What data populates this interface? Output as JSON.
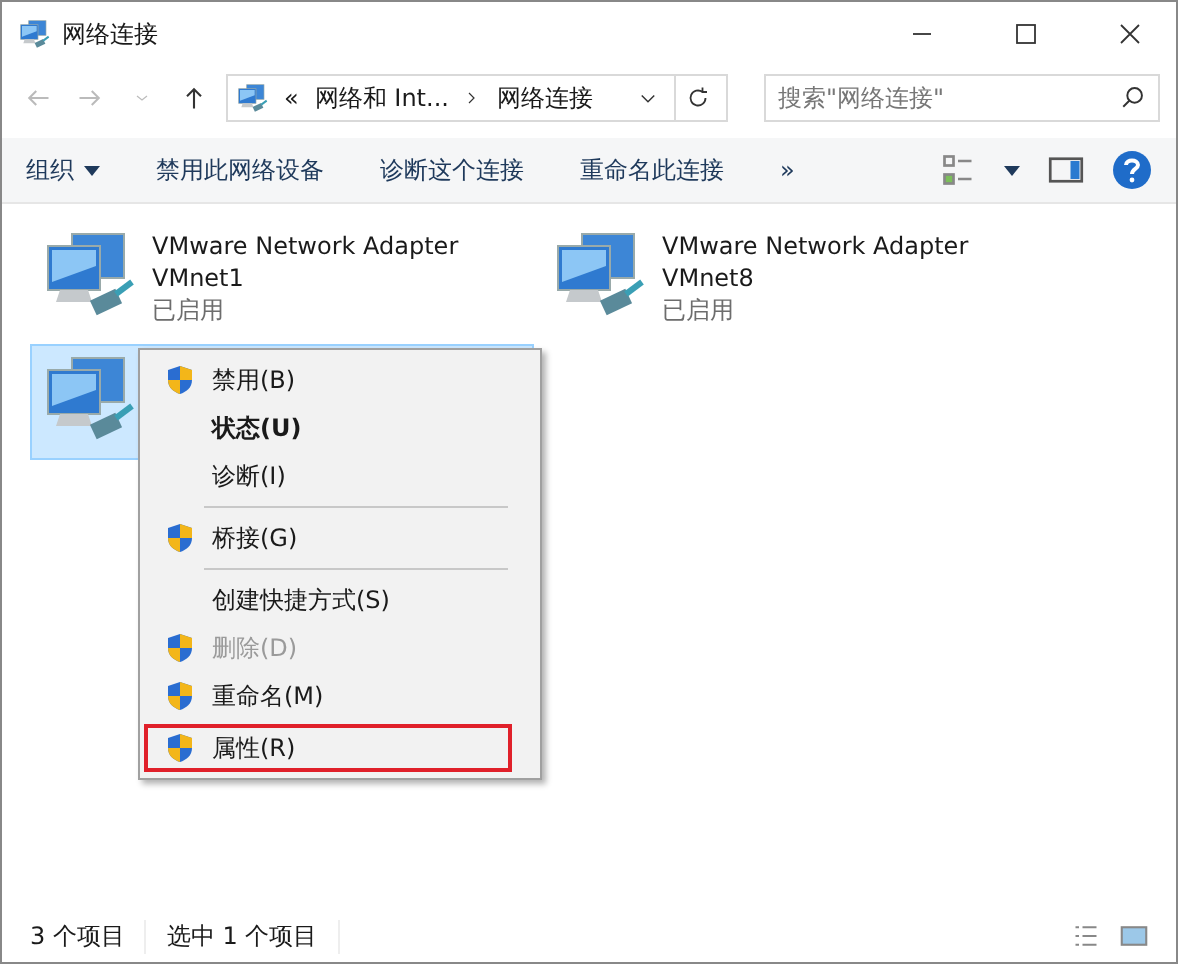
{
  "window": {
    "title": "网络连接"
  },
  "address": {
    "overflow": "«",
    "path": [
      {
        "label": "网络和 Int..."
      },
      {
        "label": "网络连接"
      }
    ]
  },
  "search": {
    "placeholder": "搜索\"网络连接\""
  },
  "toolbar": {
    "items": [
      {
        "label": "组织",
        "dropdown": true
      },
      {
        "label": "禁用此网络设备",
        "dropdown": false
      },
      {
        "label": "诊断这个连接",
        "dropdown": false
      },
      {
        "label": "重命名此连接",
        "dropdown": false
      }
    ],
    "more": "»"
  },
  "adapters": [
    {
      "name": "VMware Network Adapter",
      "device": "VMnet1",
      "status": "已启用",
      "selected": false
    },
    {
      "name": "VMware Network Adapter",
      "device": "VMnet8",
      "status": "已启用",
      "selected": false
    },
    {
      "selected": true
    }
  ],
  "context_menu": {
    "items": [
      {
        "kind": "item",
        "label": "禁用(B)",
        "shield": true,
        "bold": false,
        "disabled": false,
        "highlighted": false
      },
      {
        "kind": "item",
        "label": "状态(U)",
        "shield": false,
        "bold": true,
        "disabled": false,
        "highlighted": false
      },
      {
        "kind": "item",
        "label": "诊断(I)",
        "shield": false,
        "bold": false,
        "disabled": false,
        "highlighted": false
      },
      {
        "kind": "separator"
      },
      {
        "kind": "item",
        "label": "桥接(G)",
        "shield": true,
        "bold": false,
        "disabled": false,
        "highlighted": false
      },
      {
        "kind": "separator"
      },
      {
        "kind": "item",
        "label": "创建快捷方式(S)",
        "shield": false,
        "bold": false,
        "disabled": false,
        "highlighted": false
      },
      {
        "kind": "item",
        "label": "删除(D)",
        "shield": true,
        "bold": false,
        "disabled": true,
        "highlighted": false
      },
      {
        "kind": "item",
        "label": "重命名(M)",
        "shield": true,
        "bold": false,
        "disabled": false,
        "highlighted": false
      },
      {
        "kind": "item",
        "label": "属性(R)",
        "shield": true,
        "bold": false,
        "disabled": false,
        "highlighted": true
      }
    ]
  },
  "status_bar": {
    "items": [
      "3 个项目",
      "选中 1 个项目"
    ]
  }
}
